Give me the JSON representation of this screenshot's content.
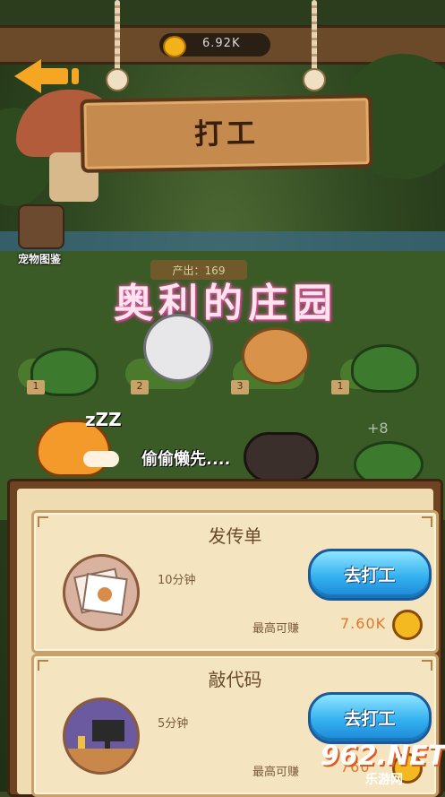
{
  "header": {
    "coins": "6.92K",
    "title": "打工"
  },
  "farm": {
    "guide_label": "宠物图鉴",
    "output_label": "产出：169",
    "manor_title": "奥利的庄园",
    "pens": [
      "1",
      "2",
      "3",
      "1"
    ],
    "plus_text": "+8",
    "sleep_text": "zZZ",
    "lazy_text": "偷偷懒先...."
  },
  "jobs": [
    {
      "title": "发传单",
      "duration": "10分钟",
      "button": "去打工",
      "earn_label": "最高可赚",
      "earn_value": "7.60K"
    },
    {
      "title": "敲代码",
      "duration": "5分钟",
      "button": "去打工",
      "earn_label": "最高可赚",
      "earn_value": "760"
    }
  ],
  "watermark": {
    "main": "962.NET",
    "sub": "乐游网"
  },
  "colors": {
    "accent": "#f5a623",
    "button_blue": "#33b0f0",
    "earn": "#e0782a",
    "title_pink": "#ffe3ef"
  },
  "icons": [
    "back-arrow-icon",
    "coin-icon",
    "turtle-icon",
    "chicken-icon",
    "rabbit-icon",
    "fox-icon",
    "pig-icon"
  ]
}
